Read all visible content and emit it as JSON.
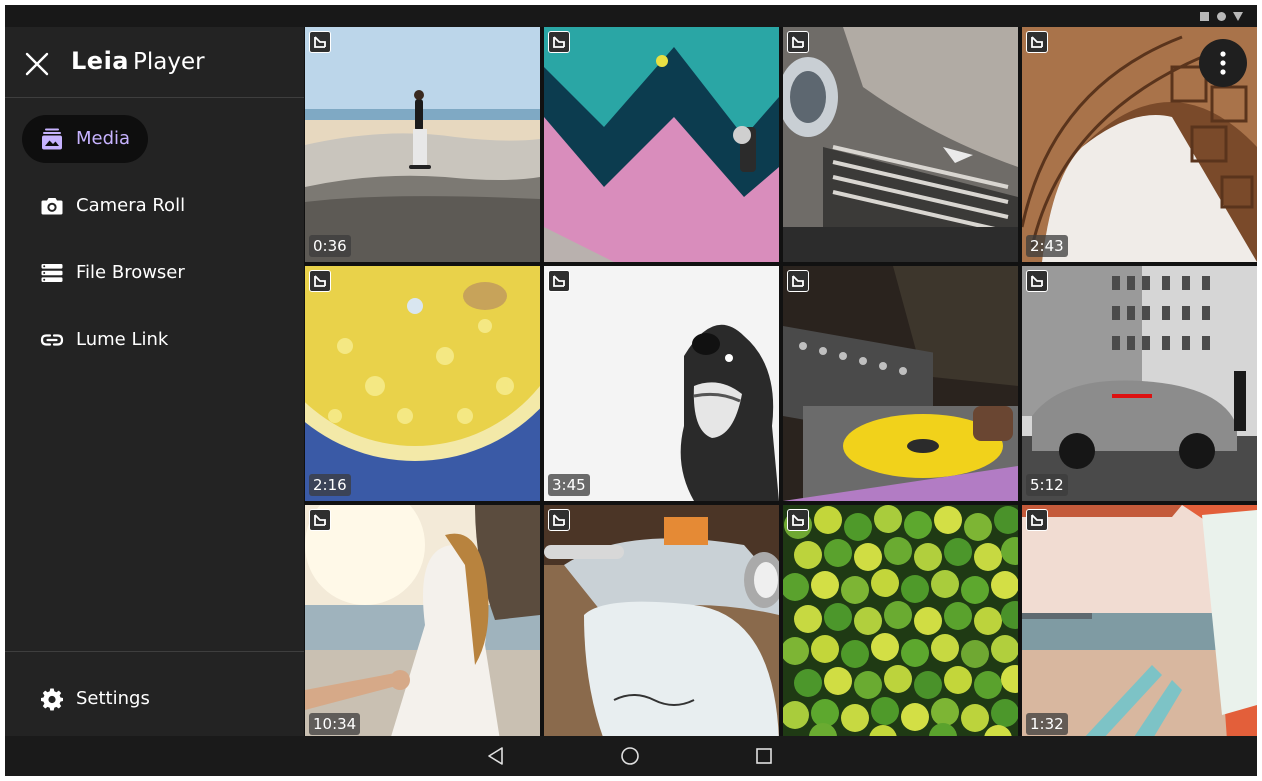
{
  "app": {
    "brand_bold": "Leia",
    "brand_light": "Player"
  },
  "sidebar": {
    "items": [
      {
        "label": "Media",
        "icon": "media-stack-icon",
        "active": true
      },
      {
        "label": "Camera Roll",
        "icon": "camera-icon",
        "active": false
      },
      {
        "label": "File Browser",
        "icon": "file-list-icon",
        "active": false
      },
      {
        "label": "Lume Link",
        "icon": "link-icon",
        "active": false
      }
    ],
    "settings_label": "Settings"
  },
  "media": [
    {
      "subject": "skatepark beach",
      "duration": "0:36"
    },
    {
      "subject": "graffiti wall",
      "duration": ""
    },
    {
      "subject": "vintage car grille",
      "duration": ""
    },
    {
      "subject": "ornate arch",
      "duration": "2:43"
    },
    {
      "subject": "lemon slice",
      "duration": "2:16"
    },
    {
      "subject": "dog",
      "duration": "3:45"
    },
    {
      "subject": "dj turntable",
      "duration": ""
    },
    {
      "subject": "sports car",
      "duration": "5:12"
    },
    {
      "subject": "woman on beach",
      "duration": "10:34"
    },
    {
      "subject": "vespa scooter",
      "duration": ""
    },
    {
      "subject": "green fruit pile",
      "duration": ""
    },
    {
      "subject": "beach lifeguard stand",
      "duration": "1:32"
    }
  ],
  "colors": {
    "accent": "#c7b3ff",
    "drawer_bg": "#232323",
    "active_pill": "#0e0e0e"
  }
}
